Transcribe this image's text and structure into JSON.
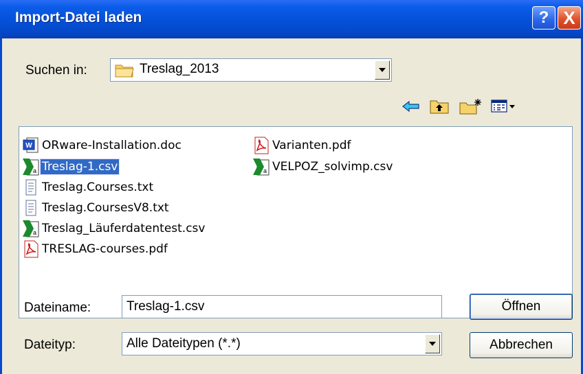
{
  "window": {
    "title": "Import-Datei laden",
    "help_label": "?",
    "close_label": "X"
  },
  "lookin": {
    "label": "Suchen in:",
    "value": "Treslag_2013"
  },
  "toolbar": {
    "icons": [
      "back-arrow-icon",
      "up-folder-icon",
      "new-folder-icon",
      "view-menu-icon"
    ]
  },
  "files": [
    {
      "name": "ORware-Installation.doc",
      "icon": "word-doc-icon"
    },
    {
      "name": "Treslag-1.csv",
      "icon": "excel-csv-icon",
      "selected": true
    },
    {
      "name": "Treslag.Courses.txt",
      "icon": "text-file-icon"
    },
    {
      "name": "Treslag.CoursesV8.txt",
      "icon": "text-file-icon"
    },
    {
      "name": "Treslag_Läuferdatentest.csv",
      "icon": "excel-csv-icon"
    },
    {
      "name": "TRESLAG-courses.pdf",
      "icon": "pdf-icon"
    },
    {
      "name": "Varianten.pdf",
      "icon": "pdf-icon"
    },
    {
      "name": "VELPOZ_solvimp.csv",
      "icon": "excel-csv-icon"
    }
  ],
  "filename": {
    "label": "Dateiname:",
    "value": "Treslag-1.csv"
  },
  "filetype": {
    "label": "Dateityp:",
    "value": "Alle Dateitypen (*.*)"
  },
  "buttons": {
    "open": "Öffnen",
    "cancel": "Abbrechen"
  }
}
